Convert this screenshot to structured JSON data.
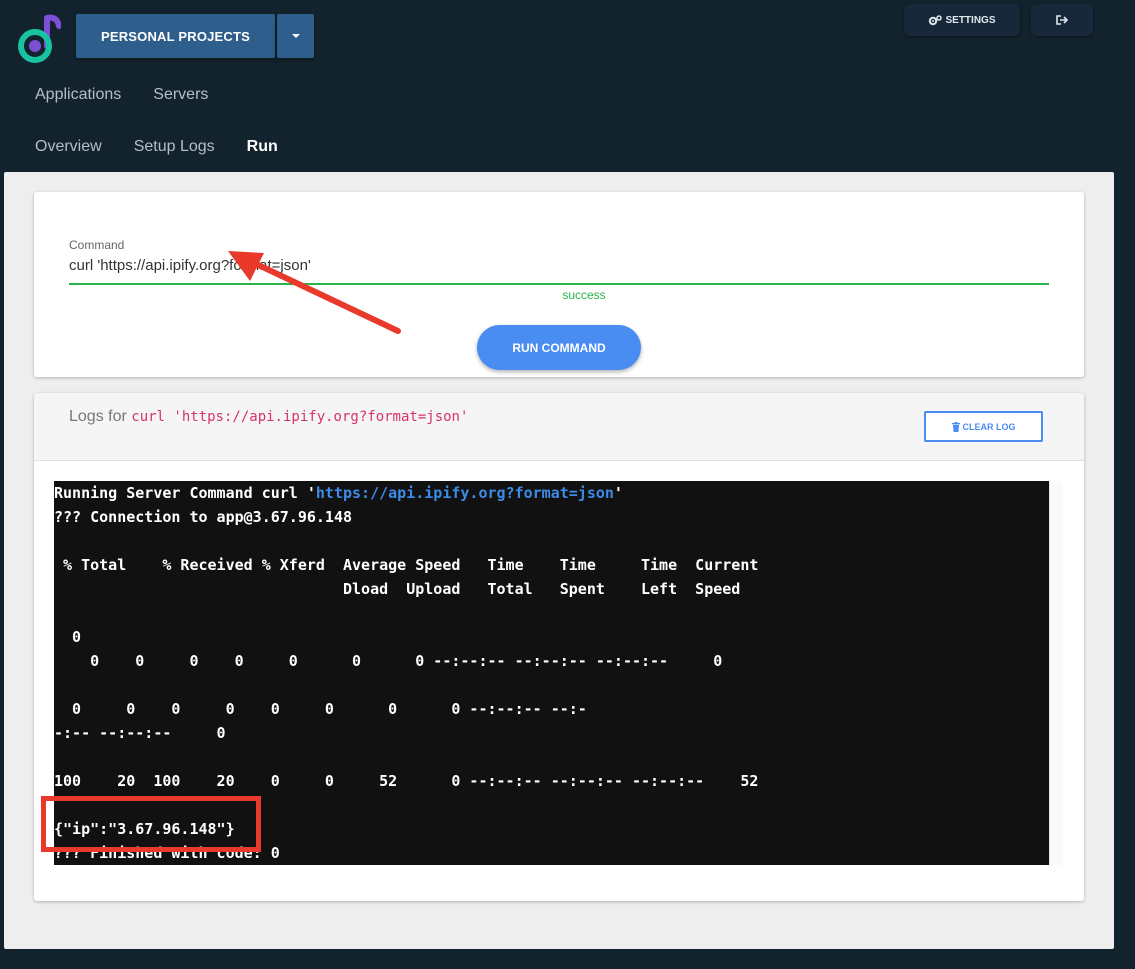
{
  "header": {
    "project_label": "PERSONAL PROJECTS",
    "settings_label": "SETTINGS"
  },
  "topnav": [
    "Applications",
    "Servers"
  ],
  "subnav": [
    {
      "label": "Overview",
      "active": false
    },
    {
      "label": "Setup Logs",
      "active": false
    },
    {
      "label": "Run",
      "active": true
    }
  ],
  "command": {
    "label": "Command",
    "value": "curl 'https://api.ipify.org?format=json'",
    "status": "success",
    "run_label": "RUN COMMAND"
  },
  "logs": {
    "title_prefix": "Logs for",
    "title_command": "curl 'https://api.ipify.org?format=json'",
    "clear_label": "CLEAR LOG",
    "terminal": {
      "run_prefix": "Running Server Command curl '",
      "run_link": "https://api.ipify.org?format=json",
      "run_suffix": "'",
      "lines": [
        "??? Connection to app@3.67.96.148",
        " % Total    % Received % Xferd  Average Speed   Time    Time     Time  Current",
        "                                Dload  Upload   Total   Spent    Left  Speed",
        "  0",
        "    0    0     0    0     0      0      0 --:--:-- --:--:-- --:--:--     0",
        "  0     0    0     0    0     0      0      0 --:--:-- --:-",
        "-:-- --:--:--     0",
        "100    20  100    20    0     0     52      0 --:--:-- --:--:-- --:--:--    52",
        "{\"ip\":\"3.67.96.148\"}",
        "??? Finished with code: 0"
      ]
    }
  },
  "colors": {
    "background": "#13232d",
    "primary": "#2e5f8c",
    "accent": "#4a8df2",
    "success": "#28b44a",
    "annotation": "#e8392b",
    "code_pink": "#d6336c"
  }
}
